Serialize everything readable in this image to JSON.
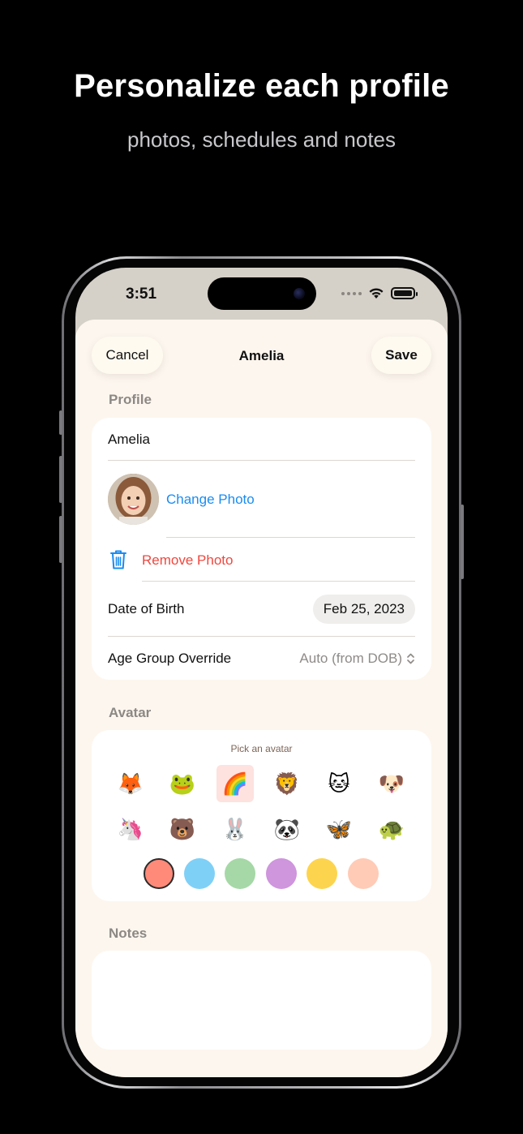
{
  "promo": {
    "title": "Personalize each profile",
    "subtitle": "photos, schedules and notes"
  },
  "status_bar": {
    "time": "3:51"
  },
  "nav": {
    "cancel_label": "Cancel",
    "title": "Amelia",
    "save_label": "Save"
  },
  "profile": {
    "section_label": "Profile",
    "name_value": "Amelia",
    "change_photo_label": "Change Photo",
    "remove_photo_label": "Remove Photo",
    "dob_label": "Date of Birth",
    "dob_value": "Feb 25, 2023",
    "age_group_label": "Age Group Override",
    "age_group_value": "Auto (from DOB)"
  },
  "avatar": {
    "section_label": "Avatar",
    "pick_label": "Pick an avatar",
    "emojis": [
      "🦊",
      "🐸",
      "🌈",
      "🦁",
      "🐱",
      "🐶",
      "🦄",
      "🐻",
      "🐰",
      "🐼",
      "🦋",
      "🐢"
    ],
    "selected_emoji_index": 2,
    "colors": [
      "#ff8a7a",
      "#7fd0f7",
      "#a5d8a6",
      "#cf95dd",
      "#fdd44d",
      "#ffcbb6"
    ],
    "selected_color_index": 0
  },
  "notes": {
    "section_label": "Notes",
    "value": ""
  },
  "icon_names": {
    "trash": "trash-icon",
    "chevron": "chevron-up-down-icon",
    "wifi": "wifi-icon",
    "battery": "battery-icon"
  }
}
